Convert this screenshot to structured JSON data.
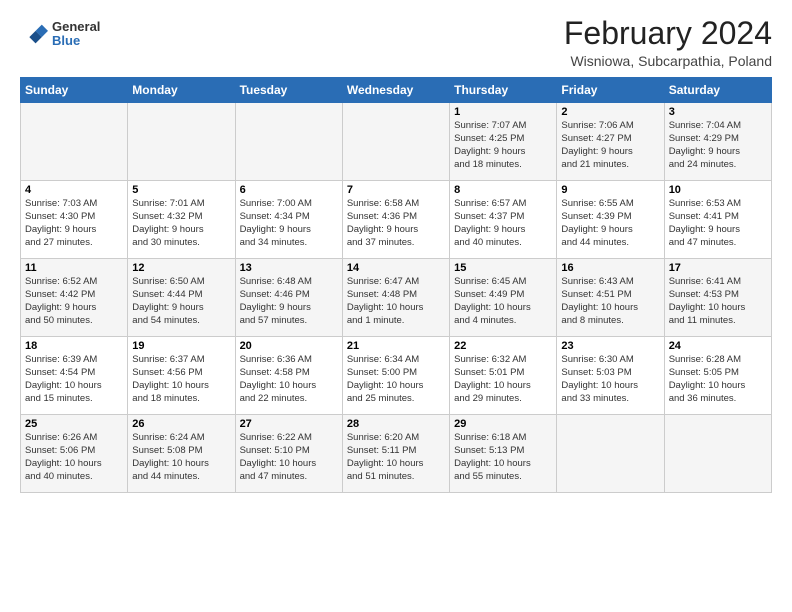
{
  "header": {
    "logo_general": "General",
    "logo_blue": "Blue",
    "title": "February 2024",
    "subtitle": "Wisniowa, Subcarpathia, Poland"
  },
  "weekdays": [
    "Sunday",
    "Monday",
    "Tuesday",
    "Wednesday",
    "Thursday",
    "Friday",
    "Saturday"
  ],
  "weeks": [
    [
      {
        "day": "",
        "info": ""
      },
      {
        "day": "",
        "info": ""
      },
      {
        "day": "",
        "info": ""
      },
      {
        "day": "",
        "info": ""
      },
      {
        "day": "1",
        "info": "Sunrise: 7:07 AM\nSunset: 4:25 PM\nDaylight: 9 hours\nand 18 minutes."
      },
      {
        "day": "2",
        "info": "Sunrise: 7:06 AM\nSunset: 4:27 PM\nDaylight: 9 hours\nand 21 minutes."
      },
      {
        "day": "3",
        "info": "Sunrise: 7:04 AM\nSunset: 4:29 PM\nDaylight: 9 hours\nand 24 minutes."
      }
    ],
    [
      {
        "day": "4",
        "info": "Sunrise: 7:03 AM\nSunset: 4:30 PM\nDaylight: 9 hours\nand 27 minutes."
      },
      {
        "day": "5",
        "info": "Sunrise: 7:01 AM\nSunset: 4:32 PM\nDaylight: 9 hours\nand 30 minutes."
      },
      {
        "day": "6",
        "info": "Sunrise: 7:00 AM\nSunset: 4:34 PM\nDaylight: 9 hours\nand 34 minutes."
      },
      {
        "day": "7",
        "info": "Sunrise: 6:58 AM\nSunset: 4:36 PM\nDaylight: 9 hours\nand 37 minutes."
      },
      {
        "day": "8",
        "info": "Sunrise: 6:57 AM\nSunset: 4:37 PM\nDaylight: 9 hours\nand 40 minutes."
      },
      {
        "day": "9",
        "info": "Sunrise: 6:55 AM\nSunset: 4:39 PM\nDaylight: 9 hours\nand 44 minutes."
      },
      {
        "day": "10",
        "info": "Sunrise: 6:53 AM\nSunset: 4:41 PM\nDaylight: 9 hours\nand 47 minutes."
      }
    ],
    [
      {
        "day": "11",
        "info": "Sunrise: 6:52 AM\nSunset: 4:42 PM\nDaylight: 9 hours\nand 50 minutes."
      },
      {
        "day": "12",
        "info": "Sunrise: 6:50 AM\nSunset: 4:44 PM\nDaylight: 9 hours\nand 54 minutes."
      },
      {
        "day": "13",
        "info": "Sunrise: 6:48 AM\nSunset: 4:46 PM\nDaylight: 9 hours\nand 57 minutes."
      },
      {
        "day": "14",
        "info": "Sunrise: 6:47 AM\nSunset: 4:48 PM\nDaylight: 10 hours\nand 1 minute."
      },
      {
        "day": "15",
        "info": "Sunrise: 6:45 AM\nSunset: 4:49 PM\nDaylight: 10 hours\nand 4 minutes."
      },
      {
        "day": "16",
        "info": "Sunrise: 6:43 AM\nSunset: 4:51 PM\nDaylight: 10 hours\nand 8 minutes."
      },
      {
        "day": "17",
        "info": "Sunrise: 6:41 AM\nSunset: 4:53 PM\nDaylight: 10 hours\nand 11 minutes."
      }
    ],
    [
      {
        "day": "18",
        "info": "Sunrise: 6:39 AM\nSunset: 4:54 PM\nDaylight: 10 hours\nand 15 minutes."
      },
      {
        "day": "19",
        "info": "Sunrise: 6:37 AM\nSunset: 4:56 PM\nDaylight: 10 hours\nand 18 minutes."
      },
      {
        "day": "20",
        "info": "Sunrise: 6:36 AM\nSunset: 4:58 PM\nDaylight: 10 hours\nand 22 minutes."
      },
      {
        "day": "21",
        "info": "Sunrise: 6:34 AM\nSunset: 5:00 PM\nDaylight: 10 hours\nand 25 minutes."
      },
      {
        "day": "22",
        "info": "Sunrise: 6:32 AM\nSunset: 5:01 PM\nDaylight: 10 hours\nand 29 minutes."
      },
      {
        "day": "23",
        "info": "Sunrise: 6:30 AM\nSunset: 5:03 PM\nDaylight: 10 hours\nand 33 minutes."
      },
      {
        "day": "24",
        "info": "Sunrise: 6:28 AM\nSunset: 5:05 PM\nDaylight: 10 hours\nand 36 minutes."
      }
    ],
    [
      {
        "day": "25",
        "info": "Sunrise: 6:26 AM\nSunset: 5:06 PM\nDaylight: 10 hours\nand 40 minutes."
      },
      {
        "day": "26",
        "info": "Sunrise: 6:24 AM\nSunset: 5:08 PM\nDaylight: 10 hours\nand 44 minutes."
      },
      {
        "day": "27",
        "info": "Sunrise: 6:22 AM\nSunset: 5:10 PM\nDaylight: 10 hours\nand 47 minutes."
      },
      {
        "day": "28",
        "info": "Sunrise: 6:20 AM\nSunset: 5:11 PM\nDaylight: 10 hours\nand 51 minutes."
      },
      {
        "day": "29",
        "info": "Sunrise: 6:18 AM\nSunset: 5:13 PM\nDaylight: 10 hours\nand 55 minutes."
      },
      {
        "day": "",
        "info": ""
      },
      {
        "day": "",
        "info": ""
      }
    ]
  ]
}
